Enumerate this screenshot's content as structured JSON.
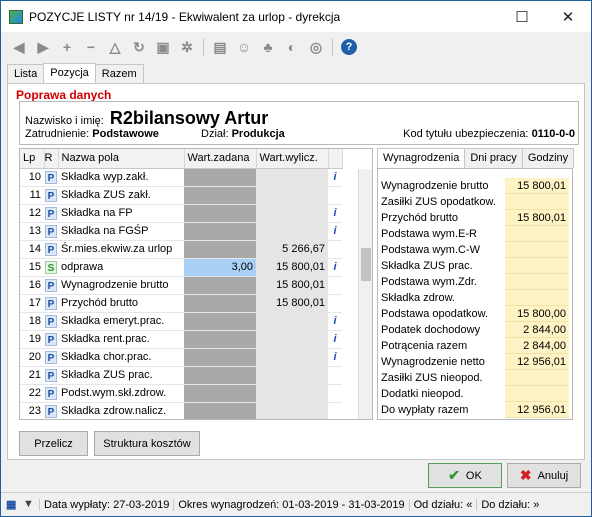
{
  "window": {
    "title": "POZYCJE LISTY nr 14/19 - Ekwiwalent za urlop - dyrekcja"
  },
  "tabs": [
    "Lista",
    "Pozycja",
    "Razem"
  ],
  "section_title": "Poprawa danych",
  "header": {
    "name_label": "Nazwisko i imię:",
    "name_value": "R2bilansowy Artur",
    "employment_label": "Zatrudnienie:",
    "employment_value": "Podstawowe",
    "dept_label": "Dział:",
    "dept_value": "Produkcja",
    "insurance_label": "Kod tytułu ubezpieczenia:",
    "insurance_value": "0110-0-0"
  },
  "grid": {
    "columns": [
      "Lp",
      "R",
      "Nazwa pola",
      "Wart.zadana",
      "Wart.wylicz."
    ],
    "rows": [
      {
        "lp": "10",
        "r": "P",
        "name": "Składka wyp.zakł.",
        "wz": "",
        "ww": "",
        "info": "i"
      },
      {
        "lp": "11",
        "r": "P",
        "name": "Składka ZUS zakł.",
        "wz": "",
        "ww": "",
        "info": ""
      },
      {
        "lp": "12",
        "r": "P",
        "name": "Składka na FP",
        "wz": "",
        "ww": "",
        "info": "i"
      },
      {
        "lp": "13",
        "r": "P",
        "name": "Składka na FGŚP",
        "wz": "",
        "ww": "",
        "info": "i"
      },
      {
        "lp": "14",
        "r": "P",
        "name": "Śr.mies.ekwiw.za urlop",
        "wz": "",
        "ww": "5 266,67",
        "info": ""
      },
      {
        "lp": "15",
        "r": "S",
        "name": "odprawa",
        "wz": "3,00",
        "ww": "15 800,01",
        "info": "i"
      },
      {
        "lp": "16",
        "r": "P",
        "name": "Wynagrodzenie brutto",
        "wz": "",
        "ww": "15 800,01",
        "info": ""
      },
      {
        "lp": "17",
        "r": "P",
        "name": "Przychód brutto",
        "wz": "",
        "ww": "15 800,01",
        "info": ""
      },
      {
        "lp": "18",
        "r": "P",
        "name": "Składka emeryt.prac.",
        "wz": "",
        "ww": "",
        "info": "i"
      },
      {
        "lp": "19",
        "r": "P",
        "name": "Składka rent.prac.",
        "wz": "",
        "ww": "",
        "info": "i"
      },
      {
        "lp": "20",
        "r": "P",
        "name": "Składka chor.prac.",
        "wz": "",
        "ww": "",
        "info": "i"
      },
      {
        "lp": "21",
        "r": "P",
        "name": "Składka ZUS prac.",
        "wz": "",
        "ww": "",
        "info": ""
      },
      {
        "lp": "22",
        "r": "P",
        "name": "Podst.wym.skł.zdrow.",
        "wz": "",
        "ww": "",
        "info": ""
      },
      {
        "lp": "23",
        "r": "P",
        "name": "Składka zdrow.nalicz.",
        "wz": "",
        "ww": "",
        "info": ""
      }
    ]
  },
  "right_tabs": [
    "Wynagrodzenia",
    "Dni pracy",
    "Godziny"
  ],
  "summary": [
    {
      "label": "Wynagrodzenie brutto",
      "value": "15 800,01"
    },
    {
      "label": "Zasiłki ZUS opodatkow.",
      "value": ""
    },
    {
      "label": "Przychód brutto",
      "value": "15 800,01"
    },
    {
      "label": "Podstawa wym.E-R",
      "value": ""
    },
    {
      "label": "Podstawa wym.C-W",
      "value": ""
    },
    {
      "label": "Składka ZUS prac.",
      "value": ""
    },
    {
      "label": "Podstawa wym.Zdr.",
      "value": ""
    },
    {
      "label": "Składka zdrow.",
      "value": ""
    },
    {
      "label": "Podstawa opodatkow.",
      "value": "15 800,00"
    },
    {
      "label": "Podatek dochodowy",
      "value": "2 844,00"
    },
    {
      "label": "Potrącenia razem",
      "value": "2 844,00"
    },
    {
      "label": "Wynagrodzenie netto",
      "value": "12 956,01"
    },
    {
      "label": "Zasiłki ZUS nieopod.",
      "value": ""
    },
    {
      "label": "Dodatki nieopod.",
      "value": ""
    },
    {
      "label": "Do wypłaty razem",
      "value": "12 956,01"
    }
  ],
  "buttons": {
    "recalc": "Przelicz",
    "cost_structure": "Struktura kosztów",
    "ok": "OK",
    "cancel": "Anuluj"
  },
  "status": {
    "payment_date": "Data wypłaty: 27-03-2019",
    "period": "Okres wynagrodzeń: 01-03-2019 - 31-03-2019",
    "from_dept": "Od działu: «",
    "to_dept": "Do działu: »"
  }
}
